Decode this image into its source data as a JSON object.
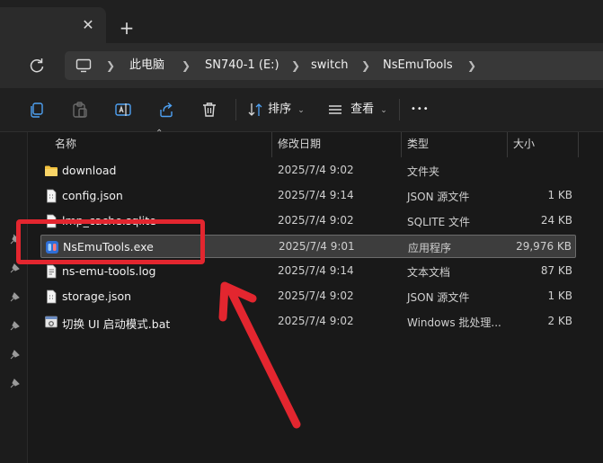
{
  "tabbar": {
    "close_icon": "close-icon",
    "new_tab_icon": "plus-icon"
  },
  "nav": {
    "breadcrumb": [
      "此电脑",
      "SN740-1 (E:)",
      "switch",
      "NsEmuTools"
    ]
  },
  "toolbar": {
    "sort_label": "排序",
    "view_label": "查看",
    "more_label": "•••"
  },
  "columns": {
    "name": "名称",
    "date": "修改日期",
    "type": "类型",
    "size": "大小"
  },
  "files": [
    {
      "name": "download",
      "date": "2025/7/4 9:02",
      "type": "文件夹",
      "size": "",
      "icon": "folder-icon"
    },
    {
      "name": "config.json",
      "date": "2025/7/4 9:14",
      "type": "JSON 源文件",
      "size": "1 KB",
      "icon": "file-icon"
    },
    {
      "name": "lmp_cache.sqlite",
      "date": "2025/7/4 9:02",
      "type": "SQLITE 文件",
      "size": "24 KB",
      "icon": "file-icon"
    },
    {
      "name": "NsEmuTools.exe",
      "date": "2025/7/4 9:01",
      "type": "应用程序",
      "size": "29,976 KB",
      "icon": "app-icon",
      "selected": true
    },
    {
      "name": "ns-emu-tools.log",
      "date": "2025/7/4 9:14",
      "type": "文本文档",
      "size": "87 KB",
      "icon": "text-file-icon"
    },
    {
      "name": "storage.json",
      "date": "2025/7/4 9:02",
      "type": "JSON 源文件",
      "size": "1 KB",
      "icon": "file-icon"
    },
    {
      "name": "切换 UI 启动模式.bat",
      "date": "2025/7/4 9:02",
      "type": "Windows 批处理...",
      "size": "2 KB",
      "icon": "batch-file-icon"
    }
  ],
  "colors": {
    "annotation": "#e3262f",
    "selection": "#3d3d3d",
    "folder": "#f3c23e"
  }
}
